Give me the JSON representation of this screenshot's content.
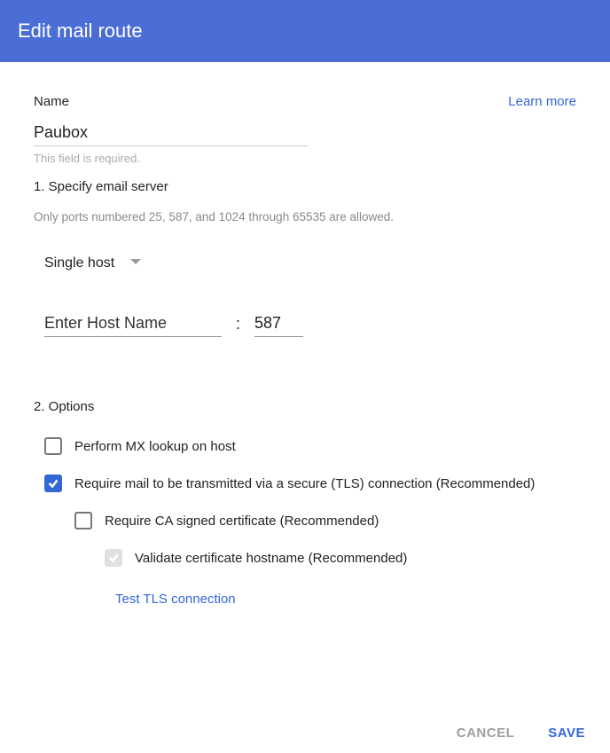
{
  "header": {
    "title": "Edit mail route"
  },
  "top": {
    "name_label": "Name",
    "learn_more": "Learn more",
    "name_value": "Paubox",
    "required_hint": "This field is required."
  },
  "section1": {
    "title": "1. Specify email server",
    "port_hint": "Only ports numbered 25, 587, and 1024 through 65535 are allowed.",
    "dropdown_value": "Single host",
    "host_placeholder": "Enter Host Name",
    "host_value": "",
    "colon": ":",
    "port_value": "587"
  },
  "section2": {
    "title": "2. Options",
    "options": [
      {
        "label": "Perform MX lookup on host",
        "checked": false,
        "disabled": false,
        "indent": 0
      },
      {
        "label": "Require mail to be transmitted via a secure (TLS) connection (Recommended)",
        "checked": true,
        "disabled": false,
        "indent": 0
      },
      {
        "label": "Require CA signed certificate (Recommended)",
        "checked": false,
        "disabled": false,
        "indent": 1
      },
      {
        "label": "Validate certificate hostname (Recommended)",
        "checked": true,
        "disabled": true,
        "indent": 2
      }
    ],
    "test_link": "Test TLS connection"
  },
  "footer": {
    "cancel": "CANCEL",
    "save": "SAVE"
  }
}
